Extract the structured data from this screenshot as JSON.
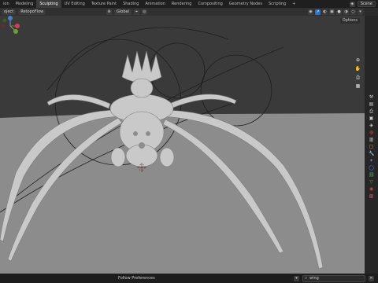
{
  "topbar": {
    "tabs": [
      "ion",
      "Modeling",
      "Sculpting",
      "UV Editing",
      "Texture Paint",
      "Shading",
      "Animation",
      "Rendering",
      "Compositing",
      "Geometry Nodes",
      "Scripting",
      "+"
    ],
    "scene_label": "Scene"
  },
  "header": {
    "mode_label": "oject",
    "object_name": "RetopoFlow",
    "orientation": "Global"
  },
  "viewport": {
    "options_label": "Options"
  },
  "statusbar": {
    "center_text": "Follow Preferences",
    "search_value": "wing"
  },
  "colors": {
    "accent": "#3c6fb0",
    "floor": "#8c8c8c",
    "horizon_bg": "#3a3a3a",
    "creature": "#c9c9c9"
  }
}
